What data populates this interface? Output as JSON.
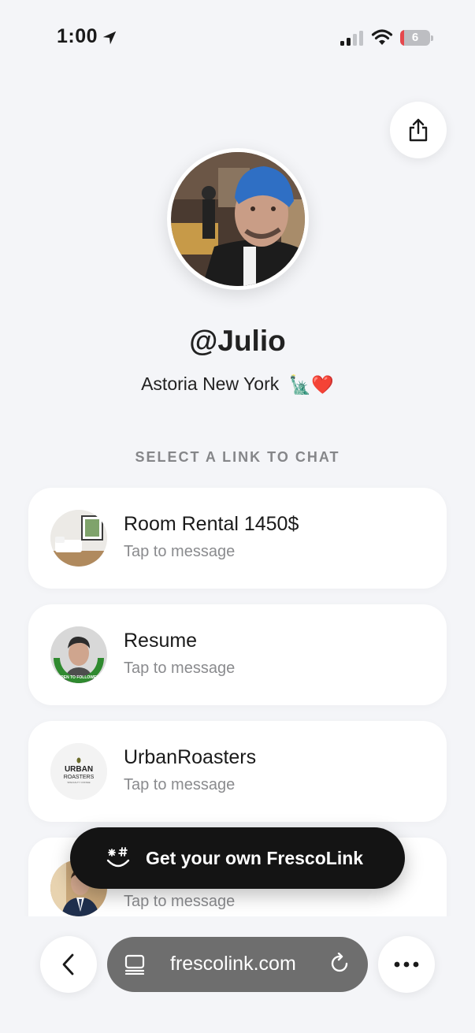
{
  "status_bar": {
    "time": "1:00",
    "battery_level": "6",
    "battery_fraction": 0.06,
    "signal_bars_active": 2,
    "signal_bars_total": 4,
    "icons": [
      "location-arrow-icon",
      "cellular-signal-icon",
      "wifi-icon",
      "battery-icon"
    ]
  },
  "header": {
    "share_icon": "share-icon"
  },
  "profile": {
    "username": "@Julio",
    "bio": "Astoria New York",
    "bio_emoji": "🗽❤️"
  },
  "links_section": {
    "label": "SELECT A LINK TO CHAT",
    "items": [
      {
        "title": "Room Rental 1450$",
        "subtitle": "Tap to message",
        "thumb": "bedroom-photo"
      },
      {
        "title": "Resume",
        "subtitle": "Tap to message",
        "thumb": "portrait-open-to-followers"
      },
      {
        "title": "UrbanRoasters",
        "subtitle": "Tap to message",
        "thumb": "urban-roasters-logo"
      },
      {
        "title": "",
        "subtitle": "Tap to message",
        "thumb": "portrait-suit"
      }
    ]
  },
  "logos": {
    "urban_roasters_line1": "URBAN",
    "urban_roasters_line2": "ROASTERS",
    "urban_roasters_line3": "SPECIALTY COFFEE",
    "open_to_followers": "#OPEN TO FOLLOWERS"
  },
  "cta": {
    "label": "Get your own FrescoLink",
    "icon": "smiley-sparkle-icon"
  },
  "browser": {
    "url": "frescolink.com",
    "back_icon": "back-chevron-icon",
    "reader_icon": "reader-mode-icon",
    "reload_icon": "reload-icon",
    "more_icon": "more-dots-icon"
  },
  "colors": {
    "background": "#f4f5f8",
    "card": "#ffffff",
    "cta_background": "#141414",
    "url_bar": "#6e6e6e",
    "battery_low": "#e5484d"
  }
}
